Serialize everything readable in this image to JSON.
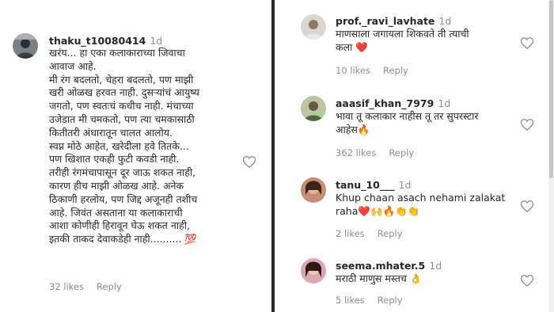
{
  "left_comment": {
    "username": "thaku_t10080414",
    "time": "1d",
    "lines": [
      "खरंय... हा एका कलाकाराच्या जिवाचा",
      "आवाज आहे.",
      "मी रंग बदलतो, चेहरा बदलतो, पण माझी",
      "खरी ओळख हरवत नाही. दुसऱ्यांचं आयुष्य",
      "जगतो, पण स्वतःचं कधीच नाही. मंचाच्या",
      "उजेडात मी चमकतो, पण त्या चमकासाठी",
      "कितीतरी अंधारातून चालत आलोय.",
      "स्वप्न मोठे आहेत, खरेदीला हवे तितके...",
      "पण खिशात एकही फुटी कवडी नाही.",
      "तरीही रंगमंचापासून दूर जाऊ शकत नाही,",
      "कारण हीच माझी ओळख आहे. अनेक",
      "ठिकाणी हरलोय, पण जिद्द अजूनही तशीच",
      "आहे. जिवंत असताना या कलाकाराची",
      "आशा कोणीही हिरावून घेऊ शकत नाही,",
      "इतकी ताकद देवाकडेही नाही.......... 💯"
    ],
    "likes": "32 likes",
    "reply": "Reply"
  },
  "right_comments": [
    {
      "username": "prof._ravi_lavhate",
      "time": "1d",
      "lines": [
        "माणसाला जगायला शिकवते ती त्याची",
        "कला ❤️"
      ],
      "likes": "10 likes",
      "reply": "Reply"
    },
    {
      "username": "aaasif_khan_7979",
      "time": "1d",
      "lines": [
        "भावा तू कलाकार नाहीस तू तर सुपरस्टार",
        "आहेस🔥"
      ],
      "likes": "362 likes",
      "reply": "Reply"
    },
    {
      "username": "tanu_10___",
      "time": "1d",
      "lines": [
        "Khup chaan asach nehami zalakat",
        "raha❤️🙌🔥👏👏"
      ],
      "likes": "2 likes",
      "reply": "Reply"
    },
    {
      "username": "seema.mhater.5",
      "time": "1d",
      "lines": [
        "मराठी माणुस मस्तच 👌"
      ],
      "likes": "5 likes",
      "reply": "Reply"
    }
  ],
  "icons": {
    "like": "heart-outline-icon",
    "avatar": "user-avatar"
  },
  "colors": {
    "text": "#262626",
    "muted": "#8e8e8e",
    "divider": "#2b2b2b"
  }
}
